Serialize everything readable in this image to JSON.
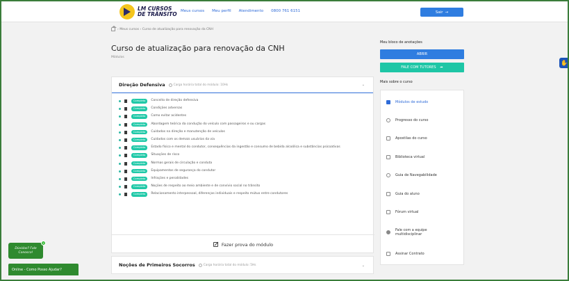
{
  "logo": {
    "line1": "LM CURSOS",
    "line2": "DE TRÂNSITO"
  },
  "nav": [
    "Meus cursos",
    "Meu perfil",
    "Atendimento",
    "0800 761 6151"
  ],
  "header": {
    "sair": "Sair",
    "sair_icon": "→"
  },
  "breadcrumb": {
    "text": "› Meus cursos › Curso de atualização para renovação da CNH"
  },
  "page": {
    "title": "Curso de atualização para renovação da CNH",
    "subtitle": "Módulos"
  },
  "module1": {
    "title": "Direção Defensiva",
    "hours": "Carga horária total do módulo: 10Hs",
    "badge": "Completo",
    "items": [
      "Conceito de direção defensiva",
      "Condições adversas",
      "Como evitar acidentes",
      "Abordagem teórica da condução do veículo com passageiros e ou cargas",
      "Cuidados na direção e manutenção de veículos",
      "Cuidados com os demais usuários da via",
      "Estado físico e mental do condutor, consequências da ingestão e consumo de bebida alcoólica e substâncias psicoativas",
      "Situações de risco",
      "Normas gerais de circulação e conduta",
      "Equipamentos de segurança do condutor",
      "Infrações e penalidades",
      "Noções de respeito ao meio ambiente e de convívio social no trânsito",
      "Relacionamento interpessoal, diferenças individuais e respeito mútuo entre condutores"
    ],
    "prova": "Fazer prova do módulo"
  },
  "module2": {
    "title": "Noções de Primeiros Socorros",
    "hours": "Carga horária total do módulo: 5Hs"
  },
  "right": {
    "notes_title": "Meu bloco de anotações",
    "abrir": "ABRIR",
    "tutor": "FALE COM TUTORES",
    "tutor_icon": "➦",
    "more_title": "Mais sobre o curso",
    "menu": [
      "Módulos de estudo",
      "Progresso do curso",
      "Apostilas do curso",
      "Biblioteca virtual",
      "Guia de Navegabilidade",
      "Guia do aluno",
      "Fórum virtual",
      "Fale com a equipe multidisciplinar",
      "Assinar Contrato"
    ]
  },
  "chat": {
    "bubble": "Dúvidas? Fale Conosco!",
    "bar": "Online - Como Posso Ajudar?",
    "close": "×"
  },
  "access_icon": "✋",
  "chevron": "⌄",
  "colors": {
    "primary": "#2f7de0",
    "teal": "#1ec6a6",
    "chat_green": "#2f8a2f"
  }
}
